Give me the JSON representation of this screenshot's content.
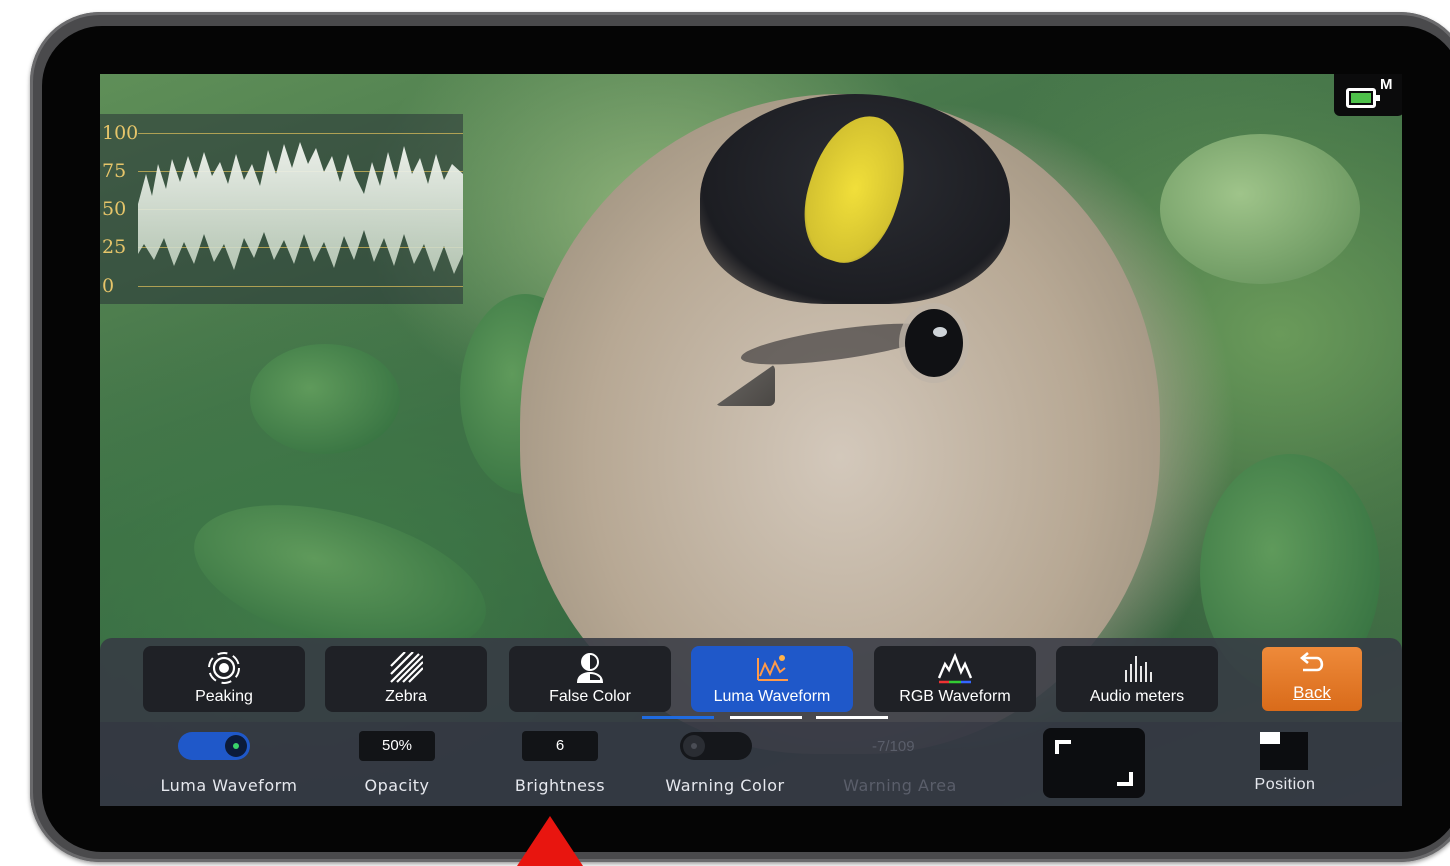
{
  "waveform": {
    "ticks": [
      "100",
      "75",
      "50",
      "25",
      "0"
    ]
  },
  "status": {
    "monitor_mode": "M"
  },
  "toolbar1": {
    "buttons": [
      {
        "label": "Peaking",
        "icon": "peaking-icon"
      },
      {
        "label": "Zebra",
        "icon": "zebra-icon"
      },
      {
        "label": "False Color",
        "icon": "false-color-icon"
      },
      {
        "label": "Luma Waveform",
        "icon": "luma-waveform-icon",
        "active": true
      },
      {
        "label": "RGB Waveform",
        "icon": "rgb-waveform-icon"
      },
      {
        "label": "Audio meters",
        "icon": "audio-meters-icon"
      }
    ],
    "back_label": "Back"
  },
  "toolbar2": {
    "luma_waveform_label": "Luma Waveform",
    "luma_waveform_enabled": true,
    "opacity_value": "50%",
    "opacity_label": "Opacity",
    "brightness_value": "6",
    "brightness_label": "Brightness",
    "warning_color_label": "Warning Color",
    "warning_color_enabled": false,
    "warning_area_value": "-7/109",
    "warning_area_label": "Warning Area",
    "position_label": "Position"
  },
  "colors": {
    "accent": "#1f58c9",
    "back_button": "#e67a28",
    "pointer_arrow": "#e8150f"
  }
}
